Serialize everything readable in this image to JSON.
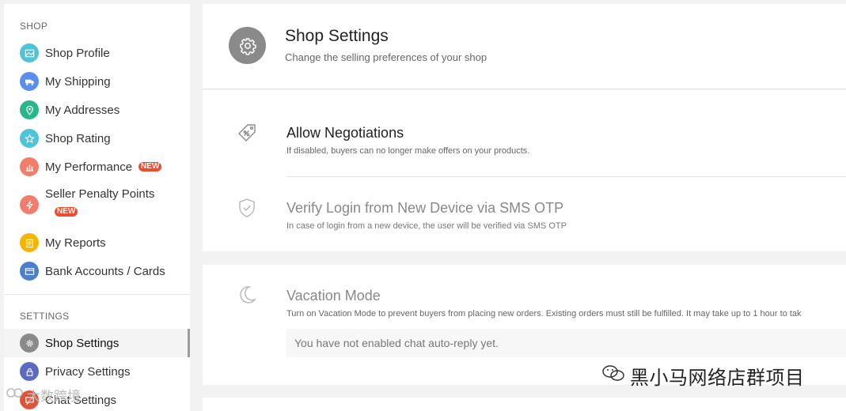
{
  "sidebar": {
    "shop_section": "SHOP",
    "settings_section": "SETTINGS",
    "shop_items": [
      {
        "label": "Shop Profile",
        "color": "#4fc3d7",
        "icon": "image-icon"
      },
      {
        "label": "My Shipping",
        "color": "#5b8def",
        "icon": "truck-icon"
      },
      {
        "label": "My Addresses",
        "color": "#26b88a",
        "icon": "location-pin-icon"
      },
      {
        "label": "Shop Rating",
        "color": "#4fc3d7",
        "icon": "star-icon"
      },
      {
        "label": "My Performance",
        "color": "#f27d6b",
        "icon": "bar-chart-icon",
        "badge": "NEW"
      },
      {
        "label": "Seller Penalty Points",
        "color": "#f27d6b",
        "icon": "lightning-icon",
        "badge": "NEW"
      },
      {
        "label": "My Reports",
        "color": "#f5b400",
        "icon": "clipboard-icon"
      },
      {
        "label": "Bank Accounts / Cards",
        "color": "#4a7fd0",
        "icon": "card-icon"
      }
    ],
    "settings_items": [
      {
        "label": "Shop Settings",
        "color": "#8a8a8a",
        "icon": "gear-icon",
        "active": true
      },
      {
        "label": "Privacy Settings",
        "color": "#5c6bc0",
        "icon": "lock-icon"
      },
      {
        "label": "Chat Settings",
        "color": "#e0533a",
        "icon": "chat-icon"
      }
    ]
  },
  "header": {
    "title": "Shop Settings",
    "subtitle": "Change the selling preferences of your shop"
  },
  "options": [
    {
      "title": "Allow Negotiations",
      "desc": "If disabled, buyers can no longer make offers on your products.",
      "icon": "price-tag-icon",
      "enabled": true
    },
    {
      "title": "Verify Login from New Device via SMS OTP",
      "desc": "In case of login from a new device, the user will be verified via SMS OTP",
      "icon": "shield-check-icon",
      "enabled": false
    }
  ],
  "vacation": {
    "title": "Vacation Mode",
    "desc": "Turn on Vacation Mode to prevent buyers from placing new orders. Existing orders must still be fulfilled. It may take up to 1 hour to tak",
    "autoreply": "You have not enabled chat auto-reply yet.",
    "icon": "moon-icon"
  },
  "watermark": {
    "text": "黑小马网络店群项目",
    "bottom_left": "大数跨境"
  }
}
